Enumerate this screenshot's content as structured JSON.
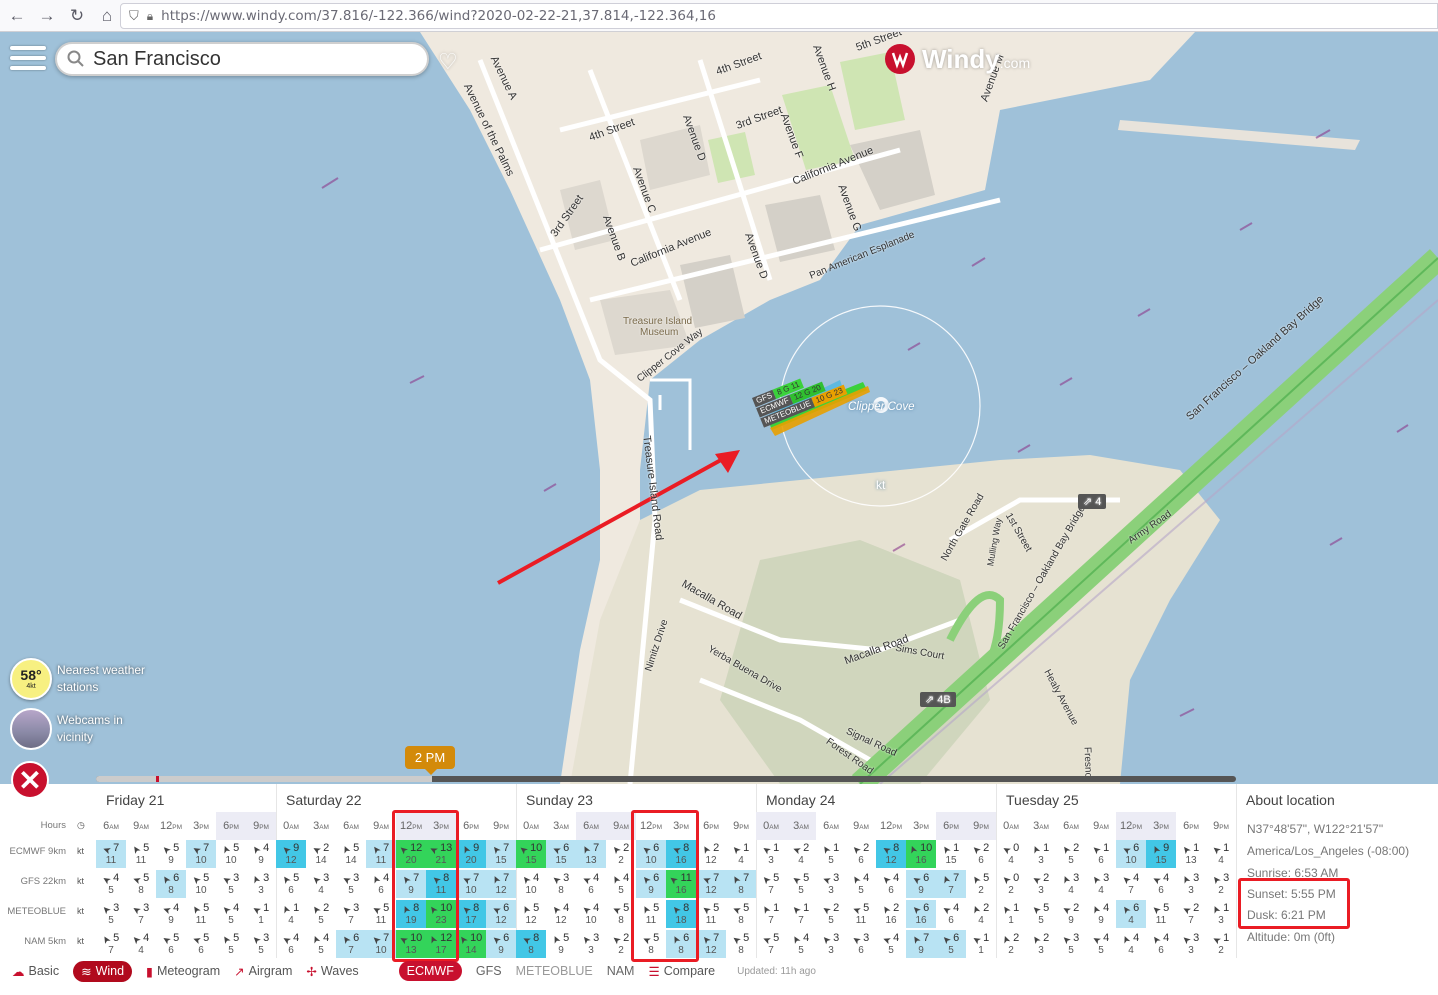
{
  "browser": {
    "url": "https://www.windy.com/37.816/-122.366/wind?2020-02-22-21,37.814,-122.364,16"
  },
  "header": {
    "search_value": "San Francisco",
    "logo_text": "Windy",
    "logo_suffix": ".com"
  },
  "map": {
    "labels": {
      "avenue_a": "Avenue A",
      "avenue_palms": "Avenue of the Palms",
      "fourth_st_a": "4th Street",
      "fourth_st_b": "4th Street",
      "third_st_a": "3rd Street",
      "third_st_b": "3rd Street",
      "fifth_st": "5th Street",
      "avenue_h": "Avenue H",
      "avenue_d_a": "Avenue D",
      "avenue_d_b": "Avenue D",
      "avenue_f": "Avenue F",
      "avenue_c": "Avenue C",
      "avenue_b": "Avenue B",
      "avenue_g": "Avenue G",
      "avenue_m": "Avenue M",
      "california_a": "California Avenue",
      "california_b": "California Avenue",
      "pan_american": "Pan American Esplanade",
      "museum_1": "Treasure Island",
      "museum_2": "Museum",
      "clipper_cove_way": "Clipper Cove Way",
      "treasure_island_road": "Treasure Island Road",
      "clipper_cove": "Clipper Cove",
      "kt": "kt",
      "bay_bridge_1": "San Francisco – Oakland Bay Bridge",
      "bay_bridge_2": "San Francisco – Oakland Bay Bridge",
      "macalla_road_a": "Macalla Road",
      "macalla_road_b": "Macalla Road",
      "nimitz": "Nimitz Drive",
      "yerba_buena": "Yerba Buena Drive",
      "signal_road": "Signal Road",
      "forest_road": "Forest Road",
      "sims_court": "Sims Court",
      "north_gate": "North Gate Road",
      "mulling": "Mulling Way",
      "first_street": "1st Street",
      "army_road": "Army Road",
      "healy": "Healy Avenue",
      "fresno": "Fresno",
      "exit_4": "4",
      "exit_4b": "4B"
    },
    "model_flags": [
      {
        "name": "GFS",
        "value": "8 G 11"
      },
      {
        "name": "ECMWF",
        "value": "12 G 20"
      },
      {
        "name": "METEOBLUE",
        "value": "10 G 23"
      }
    ],
    "nearest_temp": "58°",
    "nearest_wind": "4kt",
    "nearest_label_1": "Nearest weather",
    "nearest_label_2": "stations",
    "webcams_label_1": "Webcams in",
    "webcams_label_2": "vicinity",
    "time_bubble": "2 PM"
  },
  "forecast": {
    "days": [
      "Friday 21",
      "Saturday 22",
      "Sunday 23",
      "Monday 24",
      "Tuesday 25"
    ],
    "hours_label": "Hours",
    "hours": [
      "6AM",
      "9AM",
      "12PM",
      "3PM",
      "6PM",
      "9PM",
      "0AM",
      "3AM",
      "6AM",
      "9AM",
      "12PM",
      "3PM",
      "6PM",
      "9PM",
      "0AM",
      "3AM",
      "6AM",
      "9AM",
      "12PM",
      "3PM",
      "6PM",
      "9PM",
      "0AM",
      "3AM",
      "6AM",
      "9AM",
      "12PM",
      "3PM",
      "6PM",
      "9PM",
      "0AM",
      "3AM",
      "6AM",
      "9AM",
      "12PM",
      "3PM",
      "6PM",
      "9PM"
    ],
    "rows": [
      {
        "label": "ECMWF 9km",
        "unit": "kt",
        "wind": [
          7,
          5,
          5,
          7,
          5,
          4,
          9,
          2,
          5,
          7,
          12,
          13,
          9,
          7,
          10,
          6,
          7,
          2,
          6,
          8,
          2,
          1,
          1,
          2,
          1,
          2,
          8,
          10,
          1,
          2,
          0,
          1,
          2,
          1,
          6,
          9,
          1,
          1
        ],
        "gust": [
          11,
          11,
          9,
          10,
          10,
          9,
          12,
          14,
          14,
          11,
          20,
          21,
          20,
          15,
          15,
          15,
          13,
          2,
          10,
          16,
          12,
          4,
          3,
          4,
          5,
          6,
          12,
          16,
          15,
          6,
          4,
          3,
          5,
          6,
          10,
          15,
          13,
          4
        ]
      },
      {
        "label": "GFS 22km",
        "unit": "kt",
        "wind": [
          4,
          5,
          6,
          5,
          3,
          3,
          5,
          3,
          3,
          4,
          7,
          8,
          7,
          7,
          4,
          3,
          4,
          4,
          6,
          11,
          7,
          7,
          5,
          5,
          3,
          4,
          4,
          6,
          7,
          5,
          0,
          2,
          3,
          3,
          4,
          4,
          3,
          3
        ],
        "gust": [
          5,
          8,
          8,
          10,
          5,
          3,
          6,
          4,
          5,
          6,
          9,
          11,
          10,
          12,
          10,
          8,
          6,
          5,
          9,
          16,
          12,
          8,
          7,
          5,
          3,
          5,
          6,
          9,
          7,
          2,
          2,
          3,
          4,
          4,
          7,
          6,
          3,
          2
        ]
      },
      {
        "label": "METEOBLUE",
        "unit": "kt",
        "wind": [
          3,
          3,
          4,
          5,
          4,
          1,
          1,
          2,
          3,
          5,
          8,
          10,
          8,
          6,
          5,
          4,
          4,
          5,
          5,
          8,
          5,
          5,
          1,
          1,
          2,
          5,
          2,
          6,
          4,
          2,
          1,
          5,
          2,
          4,
          6,
          5,
          2,
          1
        ],
        "gust": [
          5,
          7,
          9,
          11,
          5,
          1,
          4,
          5,
          7,
          11,
          19,
          23,
          17,
          12,
          12,
          12,
          10,
          8,
          11,
          18,
          11,
          8,
          7,
          7,
          5,
          11,
          16,
          16,
          6,
          4,
          1,
          5,
          9,
          9,
          4,
          11,
          7,
          3
        ]
      },
      {
        "label": "NAM 5km",
        "unit": "kt",
        "wind": [
          5,
          4,
          5,
          5,
          5,
          3,
          4,
          4,
          6,
          7,
          10,
          12,
          10,
          6,
          8,
          5,
          3,
          2,
          5,
          6,
          7,
          5,
          5,
          4,
          3,
          3,
          4,
          7,
          6,
          1,
          2,
          2,
          3,
          4,
          4,
          4,
          3,
          1
        ],
        "gust": [
          7,
          4,
          6,
          6,
          5,
          5,
          6,
          5,
          7,
          10,
          13,
          17,
          14,
          9,
          8,
          9,
          3,
          2,
          8,
          8,
          12,
          8,
          7,
          5,
          3,
          6,
          5,
          9,
          5,
          1,
          2,
          3,
          5,
          5,
          4,
          6,
          3,
          2
        ]
      }
    ],
    "about": {
      "title": "About location",
      "coords": "N37°48'57\", W122°21'57\"",
      "timezone": "America/Los_Angeles (-08:00)",
      "sunrise": "Sunrise: 6:53 AM",
      "sunset": "Sunset: 5:55 PM",
      "dusk": "Dusk: 6:21 PM",
      "altitude": "Altitude: 0m (0ft)"
    }
  },
  "tabs": {
    "basic": "Basic",
    "wind": "Wind",
    "meteogram": "Meteogram",
    "airgram": "Airgram",
    "waves": "Waves",
    "models": [
      "ECMWF",
      "GFS",
      "METEOBLUE",
      "NAM"
    ],
    "active_model": "ECMWF",
    "compare": "Compare",
    "updated": "Updated: 11h ago"
  },
  "colors": {
    "windy_red": "#c8102e",
    "annotation_red": "#ea1c24",
    "water": "#9fc1d9",
    "land": "#efe9df",
    "park": "#cfe5b3",
    "highway": "#8bd07a"
  }
}
